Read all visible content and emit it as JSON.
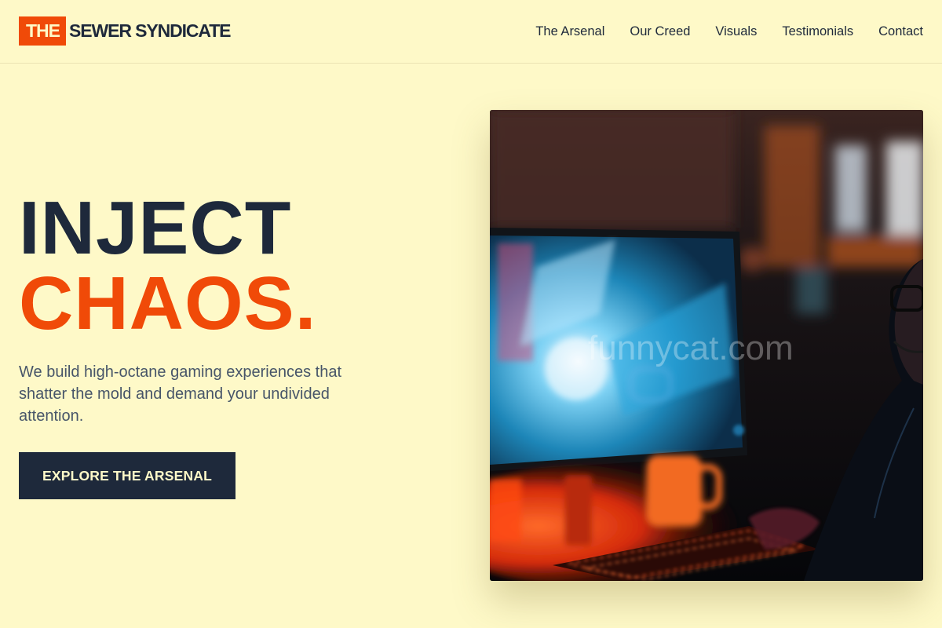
{
  "brand": {
    "mark": "THE",
    "name": "SEWER SYNDICATE",
    "accent_color": "#f04a08",
    "dark_color": "#1e293b",
    "background_color": "#fef9c8"
  },
  "nav": {
    "items": [
      {
        "label": "The Arsenal"
      },
      {
        "label": "Our Creed"
      },
      {
        "label": "Visuals"
      },
      {
        "label": "Testimonials"
      },
      {
        "label": "Contact"
      }
    ]
  },
  "hero": {
    "title_line1": "INJECT",
    "title_line2": "CHAOS.",
    "subtitle": "We build high-octane gaming experiences that shatter the mold and demand your undivided attention.",
    "cta_label": "EXPLORE THE ARSENAL"
  },
  "image": {
    "subject": "gamer-at-monitor-photo",
    "watermark": "funnycat.com"
  }
}
